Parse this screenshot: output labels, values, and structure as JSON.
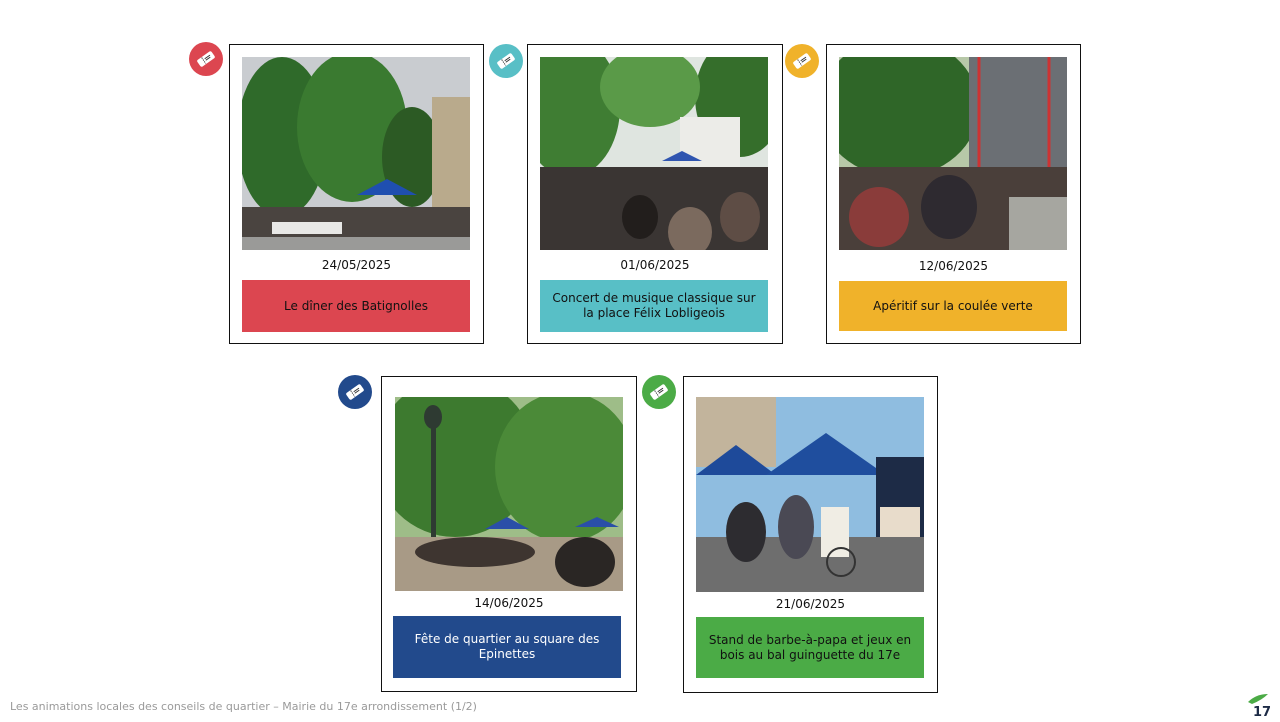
{
  "cards": [
    {
      "date": "24/05/2025",
      "label": "Le dîner des Batignolles",
      "color": "#dc4650",
      "text_color": "#111111"
    },
    {
      "date": "01/06/2025",
      "label": "Concert de musique classique sur la place Félix Lobligeois",
      "color": "#58bfc6",
      "text_color": "#111111"
    },
    {
      "date": "12/06/2025",
      "label": "Apéritif sur la coulée verte",
      "color": "#f0b22a",
      "text_color": "#111111"
    },
    {
      "date": "14/06/2025",
      "label": "Fête de quartier au square des Epinettes",
      "color": "#224a8c",
      "text_color": "#ffffff"
    },
    {
      "date": "21/06/2025",
      "label": "Stand de barbe-à-papa et jeux en bois au bal guinguette du 17e",
      "color": "#4bab46",
      "text_color": "#111111"
    }
  ],
  "footer": {
    "text": "Les animations locales des conseils de quartier – Mairie du 17e arrondissement (1/2)"
  },
  "icons": {
    "badge": "ticket-icon",
    "logo": "mairie-17-logo"
  }
}
